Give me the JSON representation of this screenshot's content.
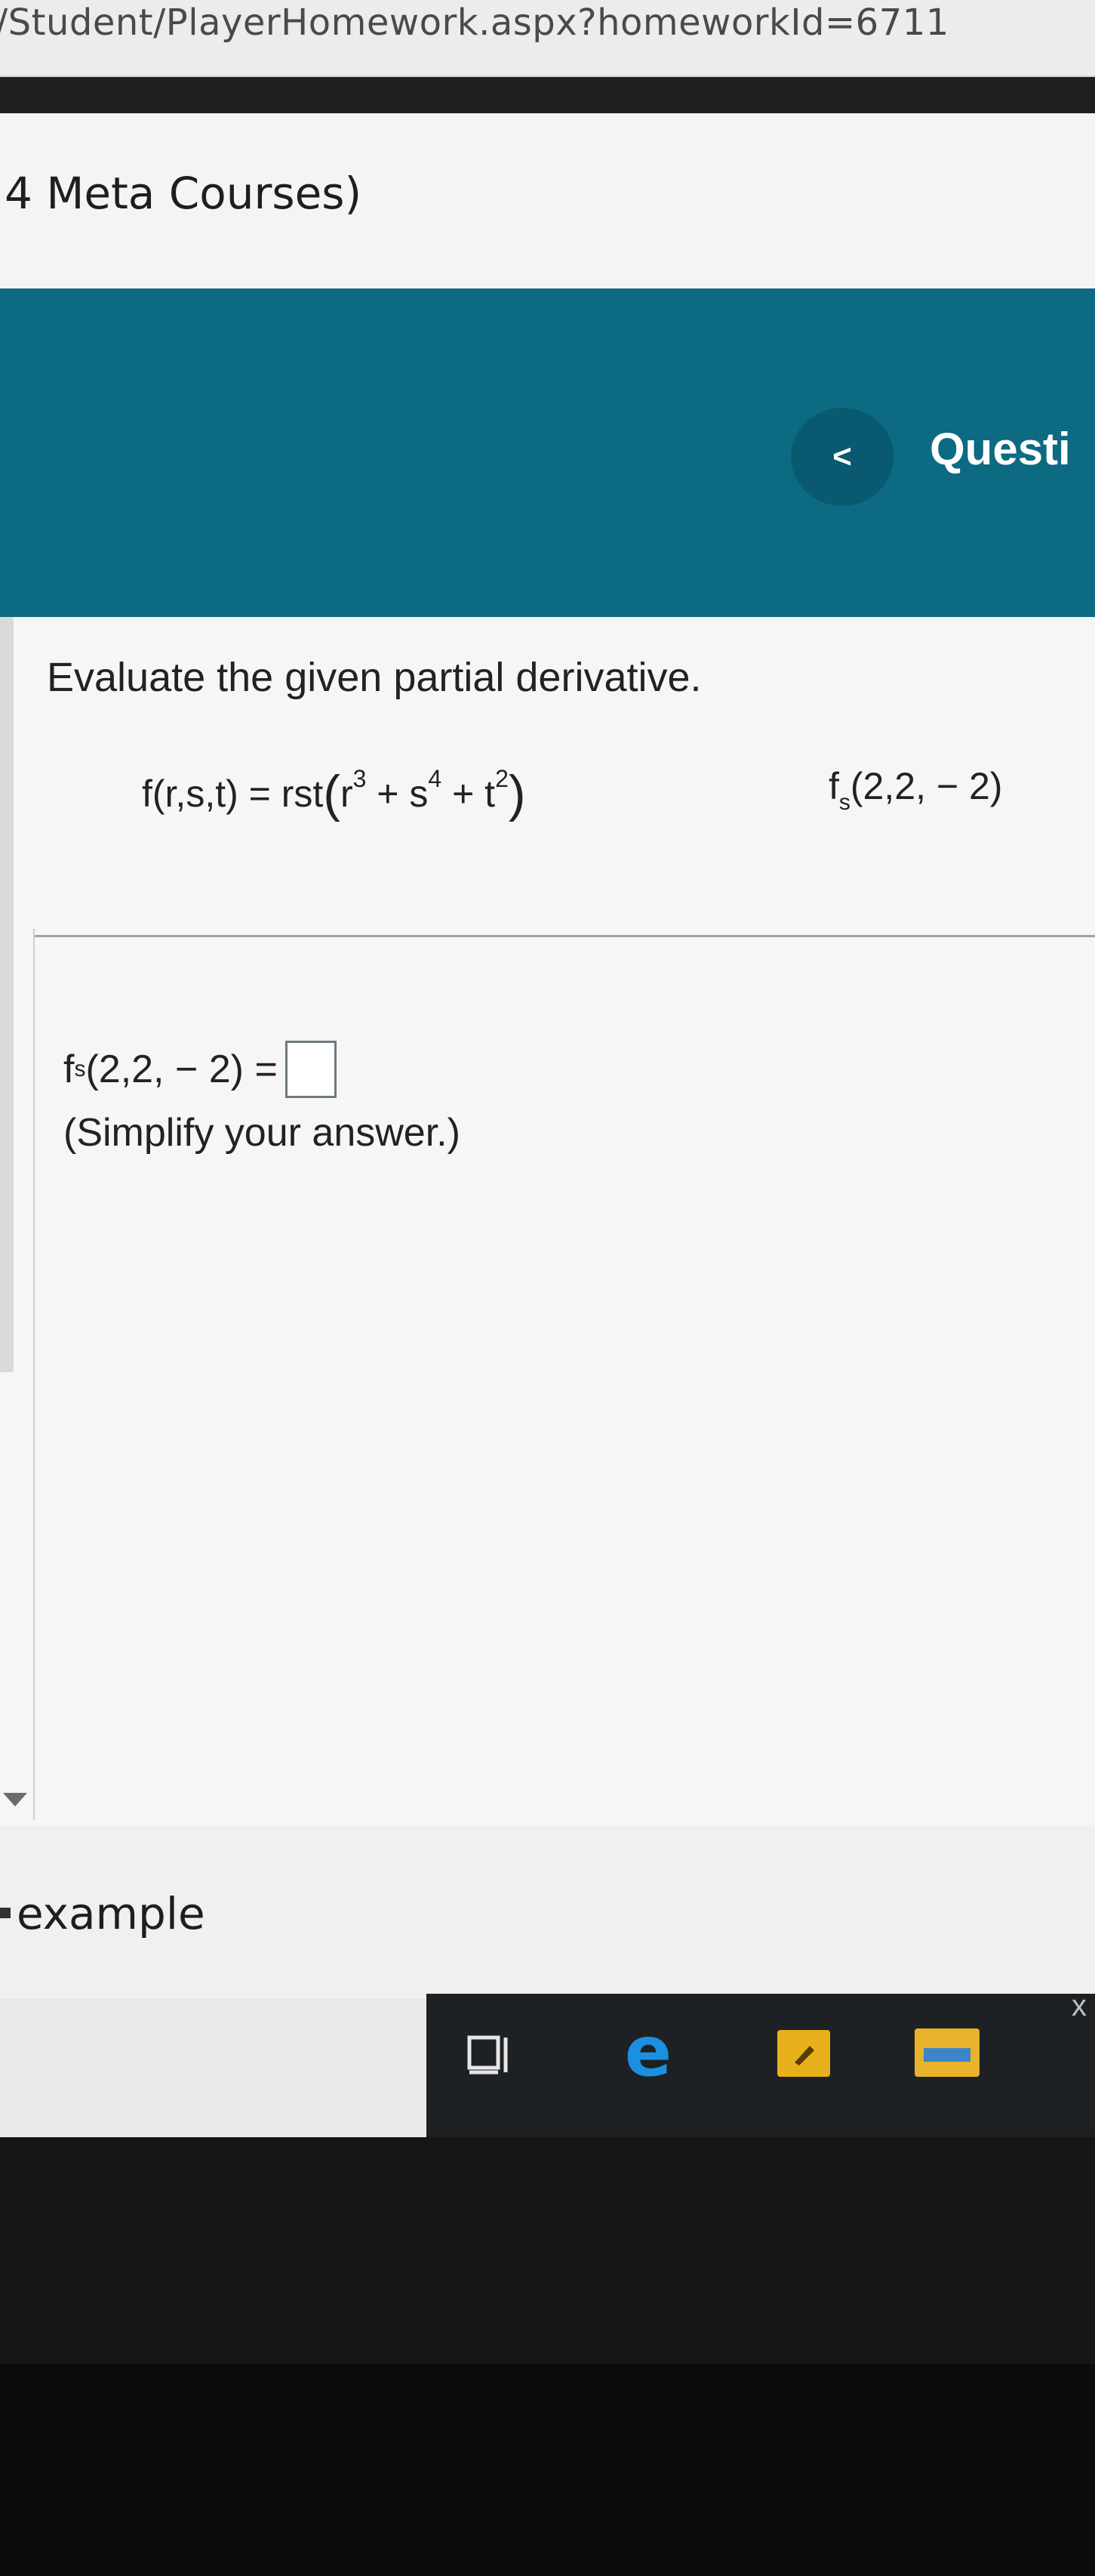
{
  "browser": {
    "url": "/Student/PlayerHomework.aspx?homeworkId=6711"
  },
  "course": {
    "title": "4 Meta Courses)"
  },
  "header": {
    "prev_label": "<",
    "question_label": "Questi"
  },
  "question": {
    "instruction": "Evaluate the given partial derivative.",
    "function_lhs": "f(r,s,t) = rst",
    "function_terms": {
      "r_base": "r",
      "r_exp": "3",
      "plus1": " + ",
      "s_base": "s",
      "s_exp": "4",
      "plus2": " + ",
      "t_base": "t",
      "t_exp": "2"
    },
    "target": {
      "f": "f",
      "sub": "s",
      "args": "(2,2, − 2)"
    }
  },
  "answer": {
    "f": "f",
    "sub": "s",
    "args": "(2,2, − 2) =",
    "hint": "(Simplify your answer.)"
  },
  "lower": {
    "example_label": "example"
  },
  "taskbar": {
    "edge_glyph": "e",
    "close_glyph": "x"
  },
  "colors": {
    "header_teal": "#0c6a83",
    "prev_button": "#095a70"
  }
}
